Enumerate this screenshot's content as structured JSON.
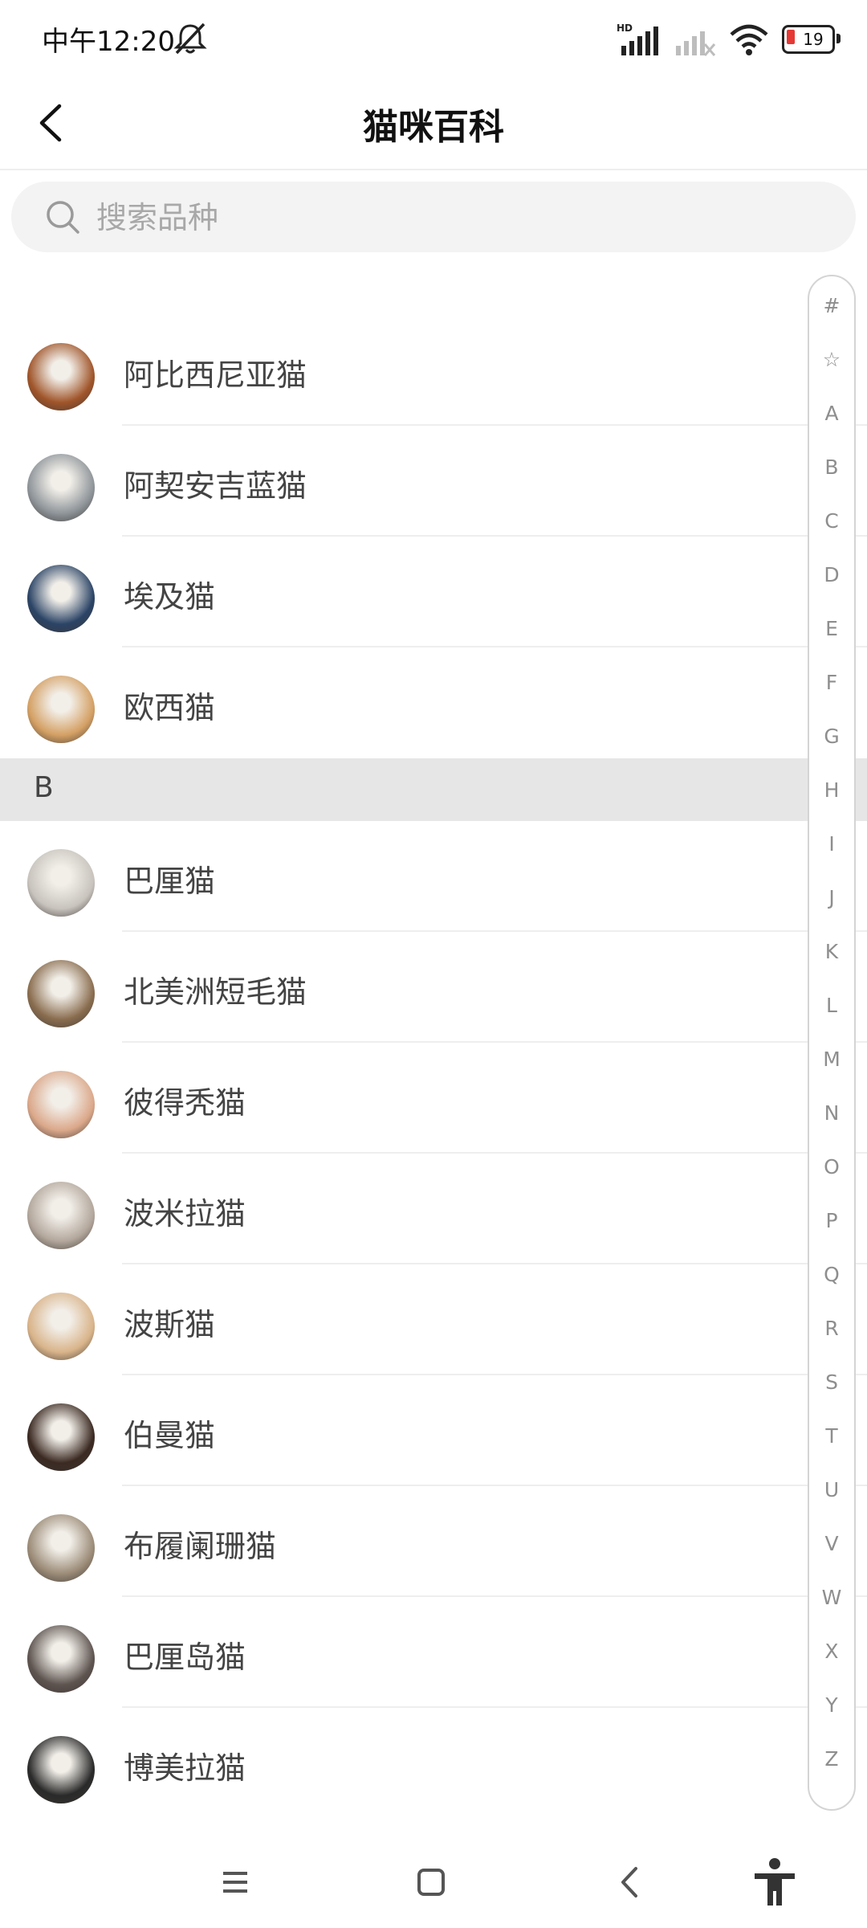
{
  "status_bar": {
    "time": "中午12:20",
    "signal_label": "HD",
    "battery": "19"
  },
  "header": {
    "title": "猫咪百科"
  },
  "search": {
    "placeholder": "搜索品种"
  },
  "sections": [
    {
      "letter": "",
      "items": [
        {
          "name": "阿比西尼亚猫",
          "avatar_color": "#a0552a"
        },
        {
          "name": "阿契安吉蓝猫",
          "avatar_color": "#8f959a"
        },
        {
          "name": "埃及猫",
          "avatar_color": "#2b4466"
        },
        {
          "name": "欧西猫",
          "avatar_color": "#d4a064"
        }
      ]
    },
    {
      "letter": "B",
      "items": [
        {
          "name": "巴厘猫",
          "avatar_color": "#c8c3bd"
        },
        {
          "name": "北美洲短毛猫",
          "avatar_color": "#8a6d4f"
        },
        {
          "name": "彼得秃猫",
          "avatar_color": "#dba88a"
        },
        {
          "name": "波米拉猫",
          "avatar_color": "#b3a79c"
        },
        {
          "name": "波斯猫",
          "avatar_color": "#d9b48a"
        },
        {
          "name": "伯曼猫",
          "avatar_color": "#3b2a22"
        },
        {
          "name": "布履阑珊猫",
          "avatar_color": "#9c8c78"
        },
        {
          "name": "巴厘岛猫",
          "avatar_color": "#5e5450"
        },
        {
          "name": "博美拉猫",
          "avatar_color": "#2a2a2a"
        }
      ]
    }
  ],
  "index_letters": [
    "#",
    "☆",
    "A",
    "B",
    "C",
    "D",
    "E",
    "F",
    "G",
    "H",
    "I",
    "J",
    "K",
    "L",
    "M",
    "N",
    "O",
    "P",
    "Q",
    "R",
    "S",
    "T",
    "U",
    "V",
    "W",
    "X",
    "Y",
    "Z"
  ],
  "nav": {
    "menu_icon": "menu-icon",
    "home_icon": "home-icon",
    "back_icon": "back-icon",
    "accessibility_icon": "accessibility-icon"
  }
}
